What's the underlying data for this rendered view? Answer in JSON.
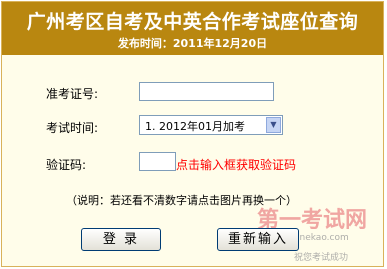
{
  "header": {
    "title": "广州考区自考及中英合作考试座位查询",
    "subtitle": "发布时间：2011年12月20日"
  },
  "form": {
    "ticket_label": "准考证号:",
    "ticket_value": "",
    "exam_time_label": "考试时间:",
    "exam_time_selected": "1. 2012年01月加考",
    "captcha_label": "验证码:",
    "captcha_value": "",
    "captcha_hint": "点击输入框获取验证码",
    "note": "（说明：若还看不清数字请点击图片再换一个）",
    "submit_label": "登 录",
    "reset_label": "重新输入"
  },
  "watermark": {
    "main": "第一考试网",
    "domain": "onekao.com",
    "slogan": "祝您考试成功"
  },
  "colors": {
    "header_bg": "#b98710",
    "panel_bg": "#fffdea",
    "hint_red": "#ff0000"
  }
}
